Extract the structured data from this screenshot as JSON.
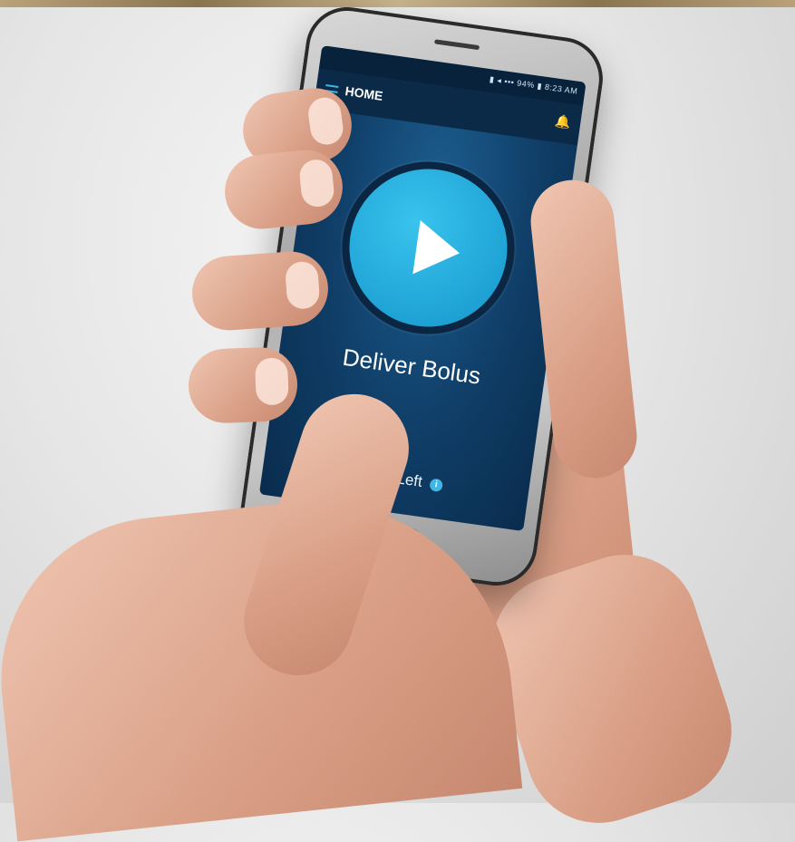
{
  "screen": {
    "status_text": "▮ ◂ ▪▪▪ 94% ▮ 8:23 AM",
    "title": "HOME",
    "primary_action_label": "Deliver Bolus",
    "doses_label": "Doses Left",
    "info_glyph": "i"
  },
  "icons": {
    "menu": "hamburger-icon",
    "notification": "bell-icon",
    "play": "play-icon",
    "info": "info-icon"
  },
  "colors": {
    "screen_bg": "#0f3d66",
    "accent": "#1fa3d6",
    "appbar": "#0b2a47"
  }
}
